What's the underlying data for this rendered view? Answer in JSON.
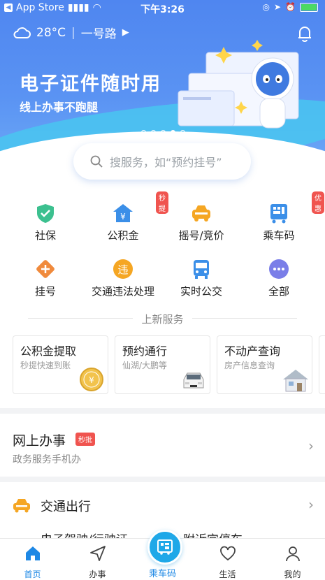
{
  "status_bar": {
    "back_app": "App Store",
    "time": "下午3:26"
  },
  "header": {
    "temperature": "28°C",
    "location": "一号路"
  },
  "banner": {
    "title": "电子证件随时用",
    "subtitle": "线上办事不跑腿"
  },
  "search": {
    "placeholder": "搜服务，如“预约挂号”"
  },
  "services": [
    {
      "label": "社保",
      "icon": "shield-check-icon",
      "color": "#3cc08f"
    },
    {
      "label": "公积金",
      "icon": "house-yen-icon",
      "color": "#3b8fe8",
      "badge": "秒提"
    },
    {
      "label": "摇号/竞价",
      "icon": "car-icon",
      "color": "#f5a623"
    },
    {
      "label": "乘车码",
      "icon": "bus-code-icon",
      "color": "#3b8fe8",
      "badge": "优惠"
    },
    {
      "label": "挂号",
      "icon": "plus-icon",
      "color": "#f08a3c"
    },
    {
      "label": "交通违法处理",
      "icon": "violation-icon",
      "color": "#f5a623"
    },
    {
      "label": "实时公交",
      "icon": "bus-icon",
      "color": "#3b8fe8"
    },
    {
      "label": "全部",
      "icon": "more-icon",
      "color": "#7a7ee8"
    }
  ],
  "new_services": {
    "title": "上新服务",
    "cards": [
      {
        "title": "公积金提取",
        "subtitle": "秒提快速到账"
      },
      {
        "title": "预约通行",
        "subtitle": "仙湖/大鹏等"
      },
      {
        "title": "不动产查询",
        "subtitle": "房产信息查询"
      }
    ]
  },
  "online_affairs": {
    "title": "网上办事",
    "badge": "秒批",
    "subtitle": "政务服务手机办"
  },
  "traffic": {
    "title": "交通出行",
    "item1": "电子驾驶/行驶证",
    "item2": "附近宜停车"
  },
  "tabbar": [
    {
      "label": "首页",
      "icon": "home-icon",
      "active": true
    },
    {
      "label": "办事",
      "icon": "send-icon"
    },
    {
      "label": "乘车码",
      "icon": "qr-bus-icon"
    },
    {
      "label": "生活",
      "icon": "heart-icon"
    },
    {
      "label": "我的",
      "icon": "user-icon"
    }
  ],
  "colors": {
    "primary": "#1e88e5",
    "banner": "#4f86f0",
    "badge": "#f0544f"
  }
}
